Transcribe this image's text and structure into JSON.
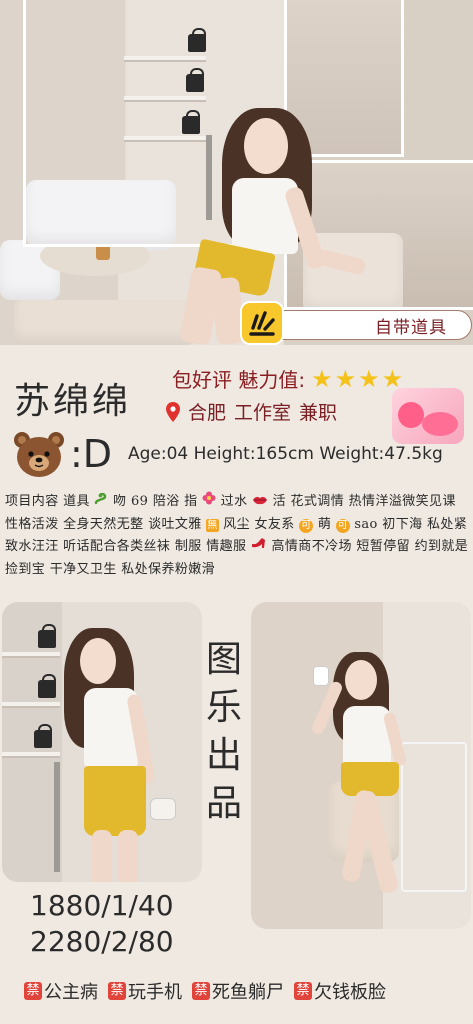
{
  "badge": {
    "label": "自带道具"
  },
  "profile": {
    "name": "苏绵绵",
    "tagline_prefix": "包好评 魅力值:",
    "stars": 4,
    "location": "合肥",
    "workplace": "工作室",
    "job_type": "兼职",
    "cup": ":D",
    "stats": "Age:04  Height:165cm  Weight:47.5kg"
  },
  "services": {
    "seg1": "项目内容 道具",
    "seg2": "吻 69 陪浴 指",
    "seg3": " 过水",
    "seg4": "活 花式调情 热情洋溢微笑见课 性格活泼 全身天然无整 谈吐文雅",
    "wu_box": "無",
    "seg5": "风尘 女友系",
    "ke_box": "可",
    "seg6": "萌",
    "seg7": "sao 初下海 私处紧致水汪汪 听话配合各类丝袜 制服 情趣服",
    "seg8": " 高情商不冷场 短暂停留 约到就是捡到宝 干净又卫生 私处保养粉嫩滑"
  },
  "vertical_title": [
    "图",
    "乐",
    "出",
    "品"
  ],
  "prices": [
    "1880/1/40",
    "2280/2/80"
  ],
  "bans": [
    {
      "box": "禁",
      "label": "公主病"
    },
    {
      "box": "禁",
      "label": "玩手机"
    },
    {
      "box": "禁",
      "label": "死鱼躺尸"
    },
    {
      "box": "禁",
      "label": "欠钱板脸"
    }
  ],
  "colors": {
    "background": "#efe9e2",
    "accent_dark_red": "#8b1e23",
    "star": "#f5c21b",
    "skirt_yellow": "#e2b92c",
    "ban_red": "#e0443a",
    "badge_yellow": "#f8c72b"
  },
  "icons": [
    "snake-icon",
    "flower-icon",
    "lips-icon",
    "pin-icon",
    "bear-icon",
    "high-heel-icon",
    "star-icon"
  ]
}
